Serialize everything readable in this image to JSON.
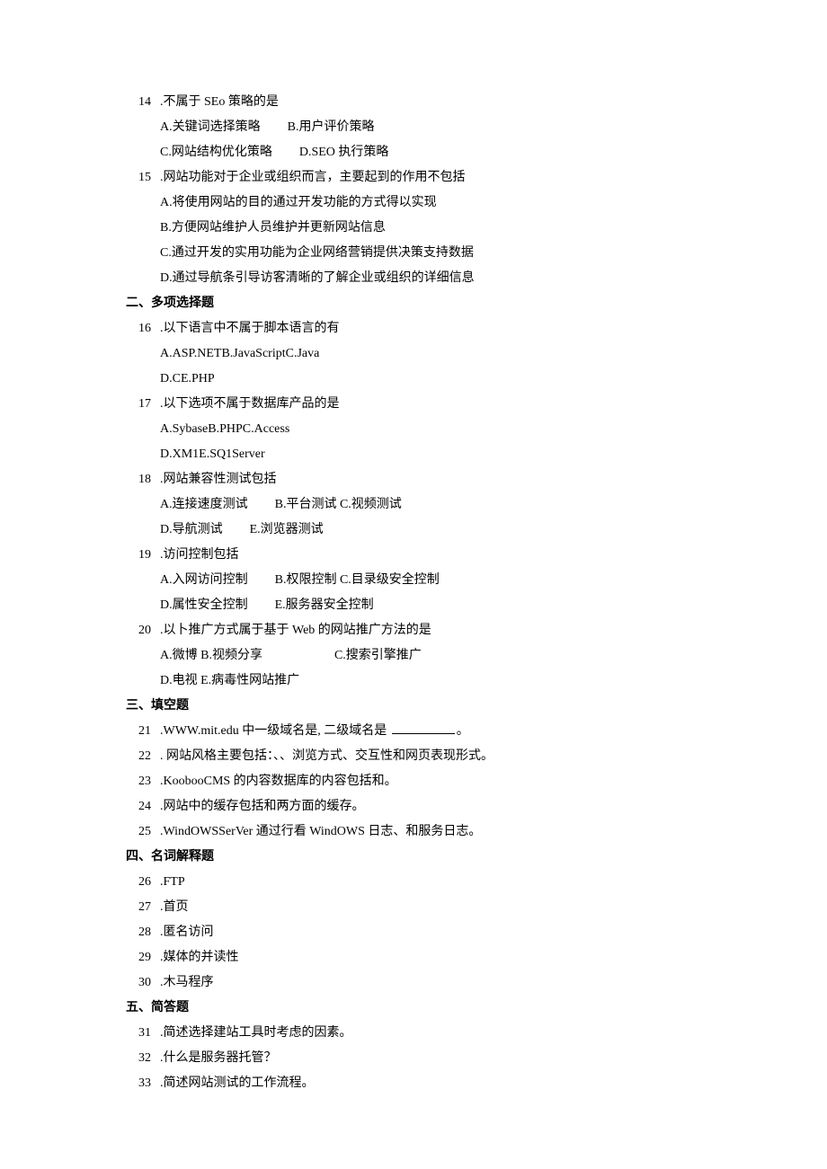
{
  "q14": {
    "num": "14",
    "stem": ".不属于 SEo 策略的是",
    "optA": "A.关键词选择策略",
    "optB": "B.用户评价策略",
    "optC": "C.网站结构优化策略",
    "optD": "D.SEO 执行策略"
  },
  "q15": {
    "num": "15",
    "stem": ".网站功能对于企业或组织而言，主要起到的作用不包括",
    "optA": "A.将使用网站的目的通过开发功能的方式得以实现",
    "optB": "B.方便网站维护人员维护并更新网站信息",
    "optC": "C.通过开发的实用功能为企业网络营销提供决策支持数据",
    "optD": "D.通过导航条引导访客清晰的了解企业或组织的详细信息"
  },
  "section2": "二、多项选择题",
  "q16": {
    "num": "16",
    "stem": ".以下语言中不属于脚本语言的有",
    "line1": "A.ASP.NETB.JavaScriptC.Java",
    "line2": "D.CE.PHP"
  },
  "q17": {
    "num": "17",
    "stem": ".以下选项不属于数据库产品的是",
    "line1": "A.SybaseB.PHPC.Access",
    "line2": "D.XM1E.SQ1Server"
  },
  "q18": {
    "num": "18",
    "stem": ".网站兼容性测试包括",
    "optA": "A.连接速度测试",
    "optBC": "B.平台测试 C.视频测试",
    "optD": "D.导航测试",
    "optE": "E.浏览器测试"
  },
  "q19": {
    "num": "19",
    "stem": ".访问控制包括",
    "optA": "A.入网访问控制",
    "optBC": "B.权限控制 C.目录级安全控制",
    "optD": "D.属性安全控制",
    "optE": "E.服务器安全控制"
  },
  "q20": {
    "num": "20",
    "stem": ".以卜推广方式属于基于 Web 的网站推广方法的是",
    "optAB": "A.微博 B.视频分享",
    "optC": "C.搜索引擎推广",
    "optDE": "D.电视 E.病毒性网站推广"
  },
  "section3": "三、填空题",
  "q21": {
    "num": "21",
    "stem_before": ".WWW.mit.edu 中一级域名是, 二级域名是 ",
    "stem_after": "。"
  },
  "q22": {
    "num": "22",
    "stem": ". 网站风格主要包括：、、浏览方式、交互性和网页表现形式。"
  },
  "q23": {
    "num": "23",
    "stem": ".KoobooCMS 的内容数据库的内容包括和。"
  },
  "q24": {
    "num": "24",
    "stem": ".网站中的缓存包括和两方面的缓存。"
  },
  "q25": {
    "num": "25",
    "stem": ".WindOWSSerVer 通过行看 WindOWS 日志、和服务日志。"
  },
  "section4": "四、名词解释题",
  "q26": {
    "num": "26",
    "stem": ".FTP"
  },
  "q27": {
    "num": "27",
    "stem": ".首页"
  },
  "q28": {
    "num": "28",
    "stem": ".匿名访问"
  },
  "q29": {
    "num": "29",
    "stem": ".媒体的并读性"
  },
  "q30": {
    "num": "30",
    "stem": ".木马程序"
  },
  "section5": "五、简答题",
  "q31": {
    "num": "31",
    "stem": ".简述选择建站工具时考虑的因素。"
  },
  "q32": {
    "num": "32",
    "stem": ".什么是服务器托管？"
  },
  "q33": {
    "num": "33",
    "stem": ".简述网站测试的工作流程。"
  }
}
